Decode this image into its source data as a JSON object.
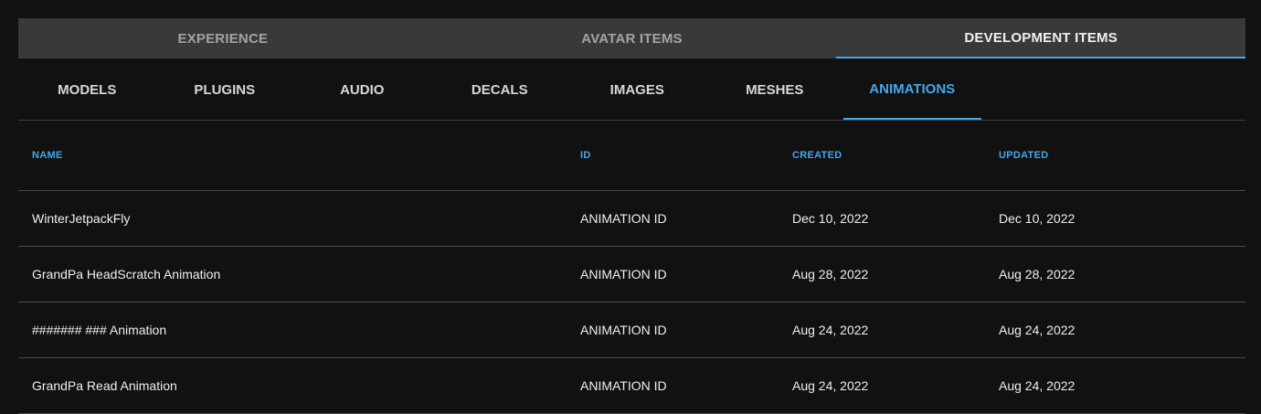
{
  "top_tabs": [
    {
      "label": "EXPERIENCE",
      "active": false
    },
    {
      "label": "AVATAR ITEMS",
      "active": false
    },
    {
      "label": "DEVELOPMENT ITEMS",
      "active": true
    }
  ],
  "sub_tabs": [
    {
      "label": "MODELS",
      "active": false
    },
    {
      "label": "PLUGINS",
      "active": false
    },
    {
      "label": "AUDIO",
      "active": false
    },
    {
      "label": "DECALS",
      "active": false
    },
    {
      "label": "IMAGES",
      "active": false
    },
    {
      "label": "MESHES",
      "active": false
    },
    {
      "label": "ANIMATIONS",
      "active": true
    }
  ],
  "table": {
    "headers": {
      "name": "NAME",
      "id": "ID",
      "created": "CREATED",
      "updated": "UPDATED"
    },
    "rows": [
      {
        "name": "WinterJetpackFly",
        "id": "ANIMATION ID",
        "created": "Dec 10, 2022",
        "updated": "Dec 10, 2022"
      },
      {
        "name": "GrandPa HeadScratch Animation",
        "id": "ANIMATION ID",
        "created": "Aug 28, 2022",
        "updated": "Aug 28, 2022"
      },
      {
        "name": "####### ### Animation",
        "id": "ANIMATION ID",
        "created": "Aug 24, 2022",
        "updated": "Aug 24, 2022"
      },
      {
        "name": "GrandPa Read Animation",
        "id": "ANIMATION ID",
        "created": "Aug 24, 2022",
        "updated": "Aug 24, 2022"
      }
    ]
  },
  "colors": {
    "background": "#111111",
    "tab_bar": "#393939",
    "accent": "#45a8e9",
    "text": "#efefef",
    "muted_text": "#a3a3a3",
    "divider": "#4a4a4a"
  }
}
